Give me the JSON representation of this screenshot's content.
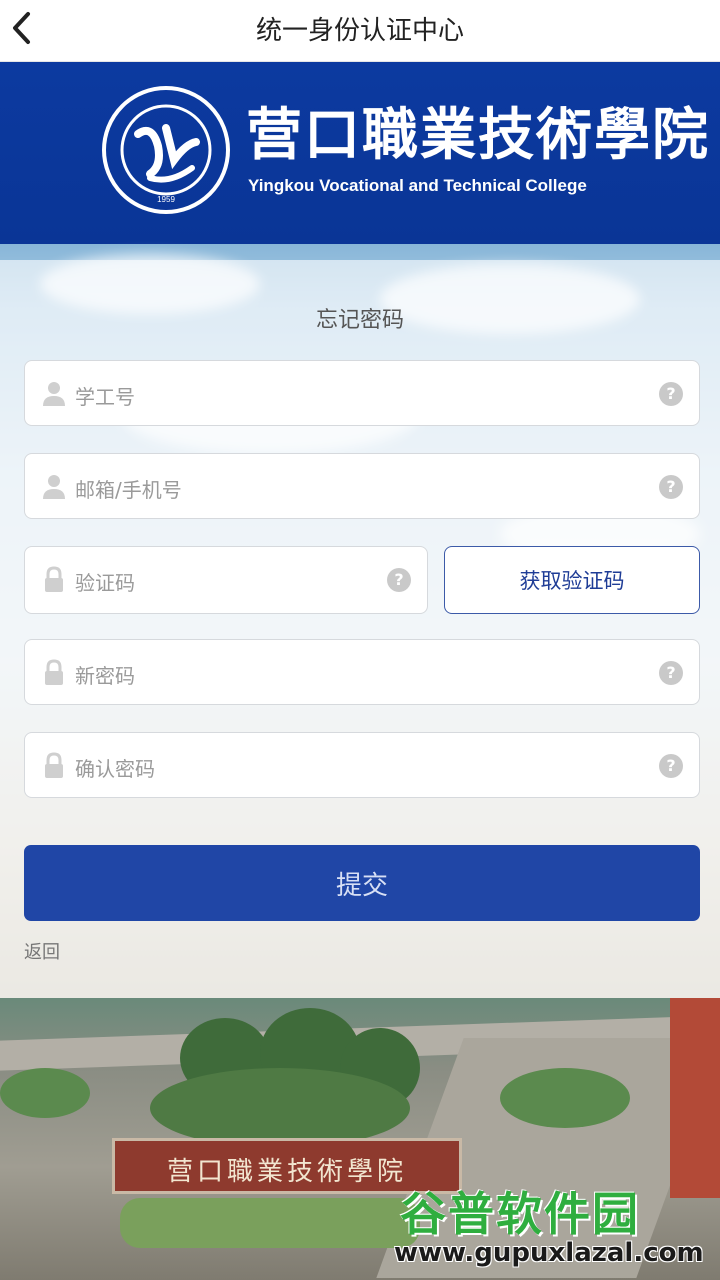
{
  "nav": {
    "title": "统一身份认证中心"
  },
  "banner": {
    "college_cn": "营口職業技術學院",
    "college_en": "Yingkou Vocational and Technical College",
    "emblem_year": "1959"
  },
  "form": {
    "title": "忘记密码",
    "fields": [
      {
        "placeholder": "学工号",
        "icon": "user-icon"
      },
      {
        "placeholder": "邮箱/手机号",
        "icon": "user-icon"
      },
      {
        "placeholder": "验证码",
        "icon": "lock-icon"
      },
      {
        "placeholder": "新密码",
        "icon": "lock-icon"
      },
      {
        "placeholder": "确认密码",
        "icon": "lock-icon"
      }
    ],
    "help_glyph": "?",
    "get_code_label": "获取验证码",
    "submit_label": "提交",
    "back_label": "返回"
  },
  "photo": {
    "gate_sign": "营口職業技術學院"
  },
  "watermark": {
    "cn": "谷普软件园",
    "en": "www.gupuxlazal.com"
  },
  "colors": {
    "banner": "#0c3aa0",
    "submit": "#2046a6",
    "accent": "#1e3c96"
  }
}
